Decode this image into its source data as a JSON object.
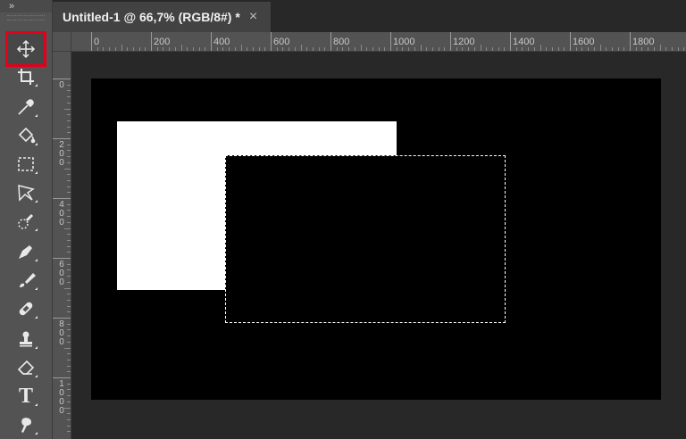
{
  "toolbar": {
    "collapse_glyph": "»",
    "tools": [
      {
        "name": "move-tool",
        "icon": "move-icon",
        "active": true
      },
      {
        "name": "crop-tool",
        "icon": "crop-icon"
      },
      {
        "name": "eyedropper-tool",
        "icon": "eyedropper-icon"
      },
      {
        "name": "paint-bucket-tool",
        "icon": "paint-bucket-icon"
      },
      {
        "name": "marquee-tool",
        "icon": "rectangular-marquee-icon"
      },
      {
        "name": "lasso-tool",
        "icon": "polygonal-lasso-icon"
      },
      {
        "name": "quick-selection-tool",
        "icon": "quick-selection-icon"
      },
      {
        "name": "pen-tool",
        "icon": "pen-icon"
      },
      {
        "name": "brush-tool",
        "icon": "brush-icon"
      },
      {
        "name": "healing-brush-tool",
        "icon": "healing-bandage-icon"
      },
      {
        "name": "clone-stamp-tool",
        "icon": "clone-stamp-icon"
      },
      {
        "name": "eraser-tool",
        "icon": "eraser-icon"
      },
      {
        "name": "type-tool",
        "icon": "type-icon",
        "glyph": "T"
      },
      {
        "name": "smudge-tool",
        "icon": "smudge-icon"
      }
    ],
    "active_highlight_color": "#e3001b"
  },
  "tab": {
    "title": "Untitled-1 @ 66,7% (RGB/8#) *",
    "close_glyph": "×"
  },
  "ruler_h": [
    "0",
    "200",
    "400",
    "600",
    "800",
    "1000",
    "1200",
    "1400",
    "1600",
    "1800"
  ],
  "ruler_v": [
    "0",
    "200",
    "400",
    "600",
    "800",
    "1000"
  ],
  "colors": {
    "canvas": "#000000",
    "shape": "#ffffff",
    "panel": "#535353",
    "workspace": "#282828"
  }
}
